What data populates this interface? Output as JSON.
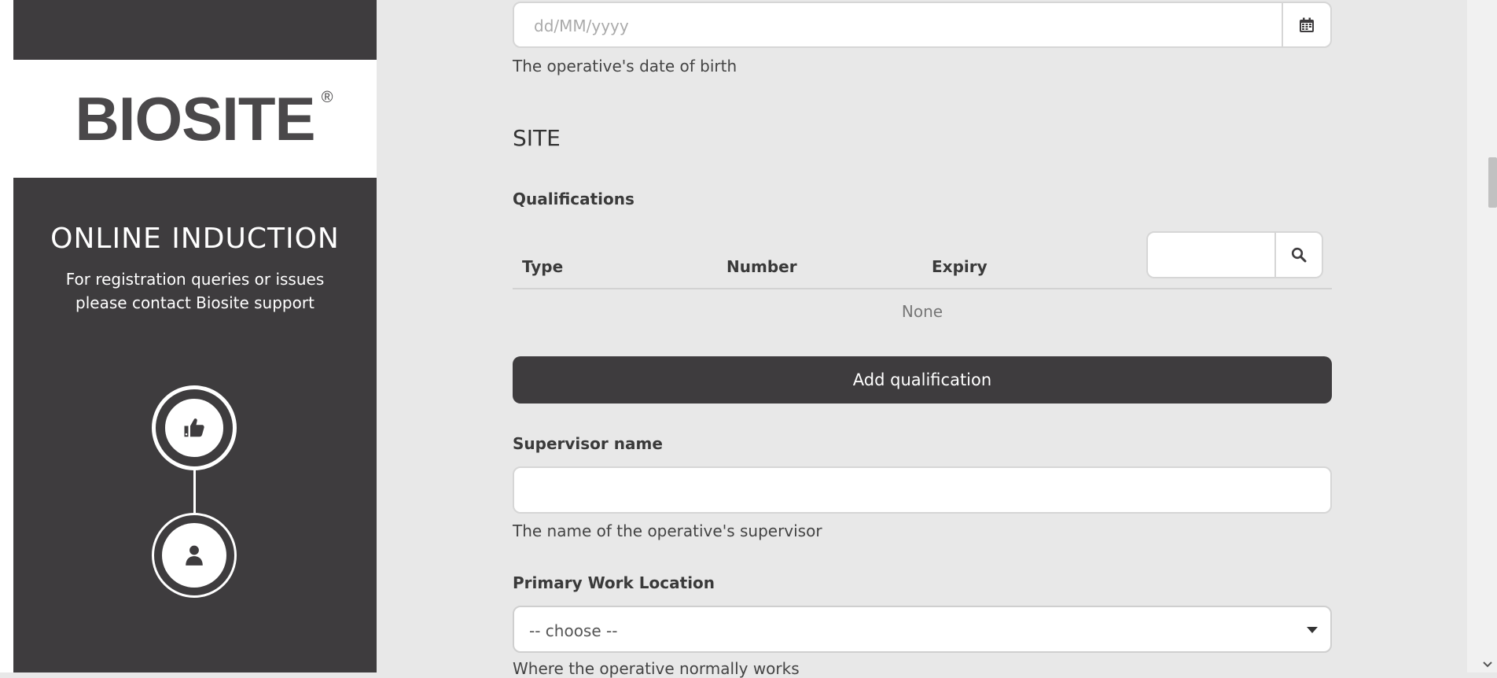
{
  "brand": {
    "logo_text": "BIOSITE",
    "logo_mark": "®"
  },
  "sidebar": {
    "title": "ONLINE INDUCTION",
    "subtitle_line1": "For registration queries or issues",
    "subtitle_line2": "please contact Biosite support",
    "steps": [
      {
        "icon": "thumbs-up-icon",
        "active": true
      },
      {
        "icon": "user-icon",
        "active": false
      }
    ]
  },
  "form": {
    "dob": {
      "placeholder": "dd/MM/yyyy",
      "help": "The operative's date of birth"
    },
    "section_title": "SITE",
    "qualifications": {
      "label": "Qualifications",
      "columns": [
        "Type",
        "Number",
        "Expiry"
      ],
      "search_value": "",
      "empty_text": "None",
      "add_button": "Add qualification"
    },
    "supervisor": {
      "label": "Supervisor name",
      "value": "",
      "help": "The name of the operative's supervisor"
    },
    "primary_location": {
      "label": "Primary Work Location",
      "selected": "-- choose --",
      "help": "Where the operative normally works"
    }
  },
  "colors": {
    "sidebar_bg": "#3e3c3e",
    "main_bg": "#e8e8e8",
    "button_bg": "#3e3c3e"
  }
}
